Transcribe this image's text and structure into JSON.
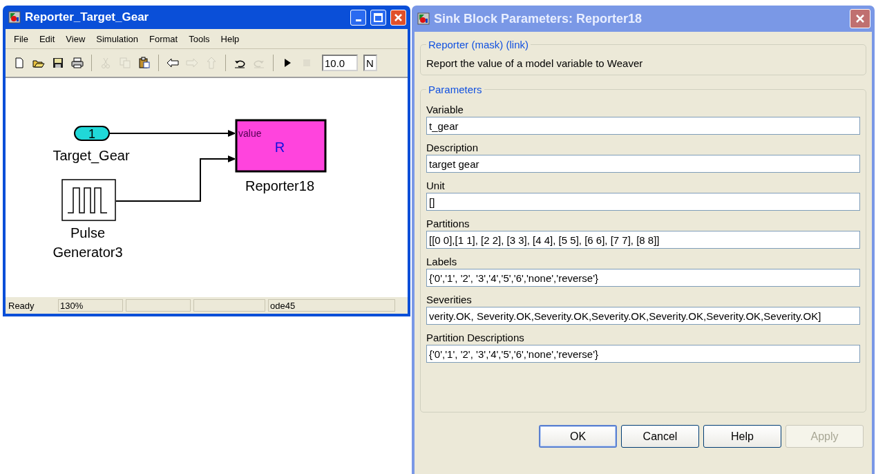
{
  "diagram_window": {
    "title": "Reporter_Target_Gear",
    "menu": [
      "File",
      "Edit",
      "View",
      "Simulation",
      "Format",
      "Tools",
      "Help"
    ],
    "toolbar": [
      {
        "kind": "new",
        "disabled": false
      },
      {
        "kind": "open",
        "disabled": false
      },
      {
        "kind": "save",
        "disabled": false
      },
      {
        "kind": "print",
        "disabled": false
      },
      {
        "kind": "separator"
      },
      {
        "kind": "cut",
        "disabled": true
      },
      {
        "kind": "copy",
        "disabled": true
      },
      {
        "kind": "paste",
        "disabled": false
      },
      {
        "kind": "separator"
      },
      {
        "kind": "back",
        "disabled": false
      },
      {
        "kind": "forward",
        "disabled": true
      },
      {
        "kind": "up",
        "disabled": true
      },
      {
        "kind": "separator"
      },
      {
        "kind": "undo",
        "disabled": false
      },
      {
        "kind": "redo",
        "disabled": true
      },
      {
        "kind": "separator"
      },
      {
        "kind": "play",
        "disabled": false
      },
      {
        "kind": "stop",
        "disabled": true
      }
    ],
    "stop_time": {
      "value": "10.0"
    },
    "mode_field": {
      "value": "N"
    },
    "inport": {
      "number": "1",
      "name": "Target_Gear"
    },
    "pulse": {
      "name_lines": [
        "Pulse",
        "Generator3"
      ]
    },
    "reporter": {
      "port_label": "value",
      "glyph": "R",
      "name": "Reporter18"
    },
    "status_bar": {
      "state": "Ready",
      "zoom": "130%",
      "solver": "ode45"
    }
  },
  "dialog": {
    "title": "Sink Block Parameters: Reporter18",
    "description": {
      "title": "Reporter (mask) (link)",
      "text": "Report the value of a model variable to Weaver"
    },
    "parameters": {
      "title": "Parameters",
      "fields": [
        {
          "label": "Variable",
          "value": "t_gear"
        },
        {
          "label": "Description",
          "value": "target gear"
        },
        {
          "label": "Unit",
          "value": "[]"
        },
        {
          "label": "Partitions",
          "value": "[[0 0],[1 1], [2 2], [3 3], [4 4], [5 5], [6 6], [7 7], [8 8]]"
        },
        {
          "label": "Labels",
          "value": "{'0','1', '2', '3','4','5','6','none','reverse'}"
        },
        {
          "label": "Severities",
          "value": "verity.OK, Severity.OK,Severity.OK,Severity.OK,Severity.OK,Severity.OK,Severity.OK]"
        },
        {
          "label": "Partition Descriptions",
          "value": "{'0','1', '2', '3','4','5','6','none','reverse'}"
        }
      ]
    },
    "buttons": [
      {
        "label": "OK",
        "default": true,
        "disabled": false
      },
      {
        "label": "Cancel",
        "default": false,
        "disabled": false
      },
      {
        "label": "Help",
        "default": false,
        "disabled": false
      },
      {
        "label": "Apply",
        "default": false,
        "disabled": true
      }
    ]
  }
}
